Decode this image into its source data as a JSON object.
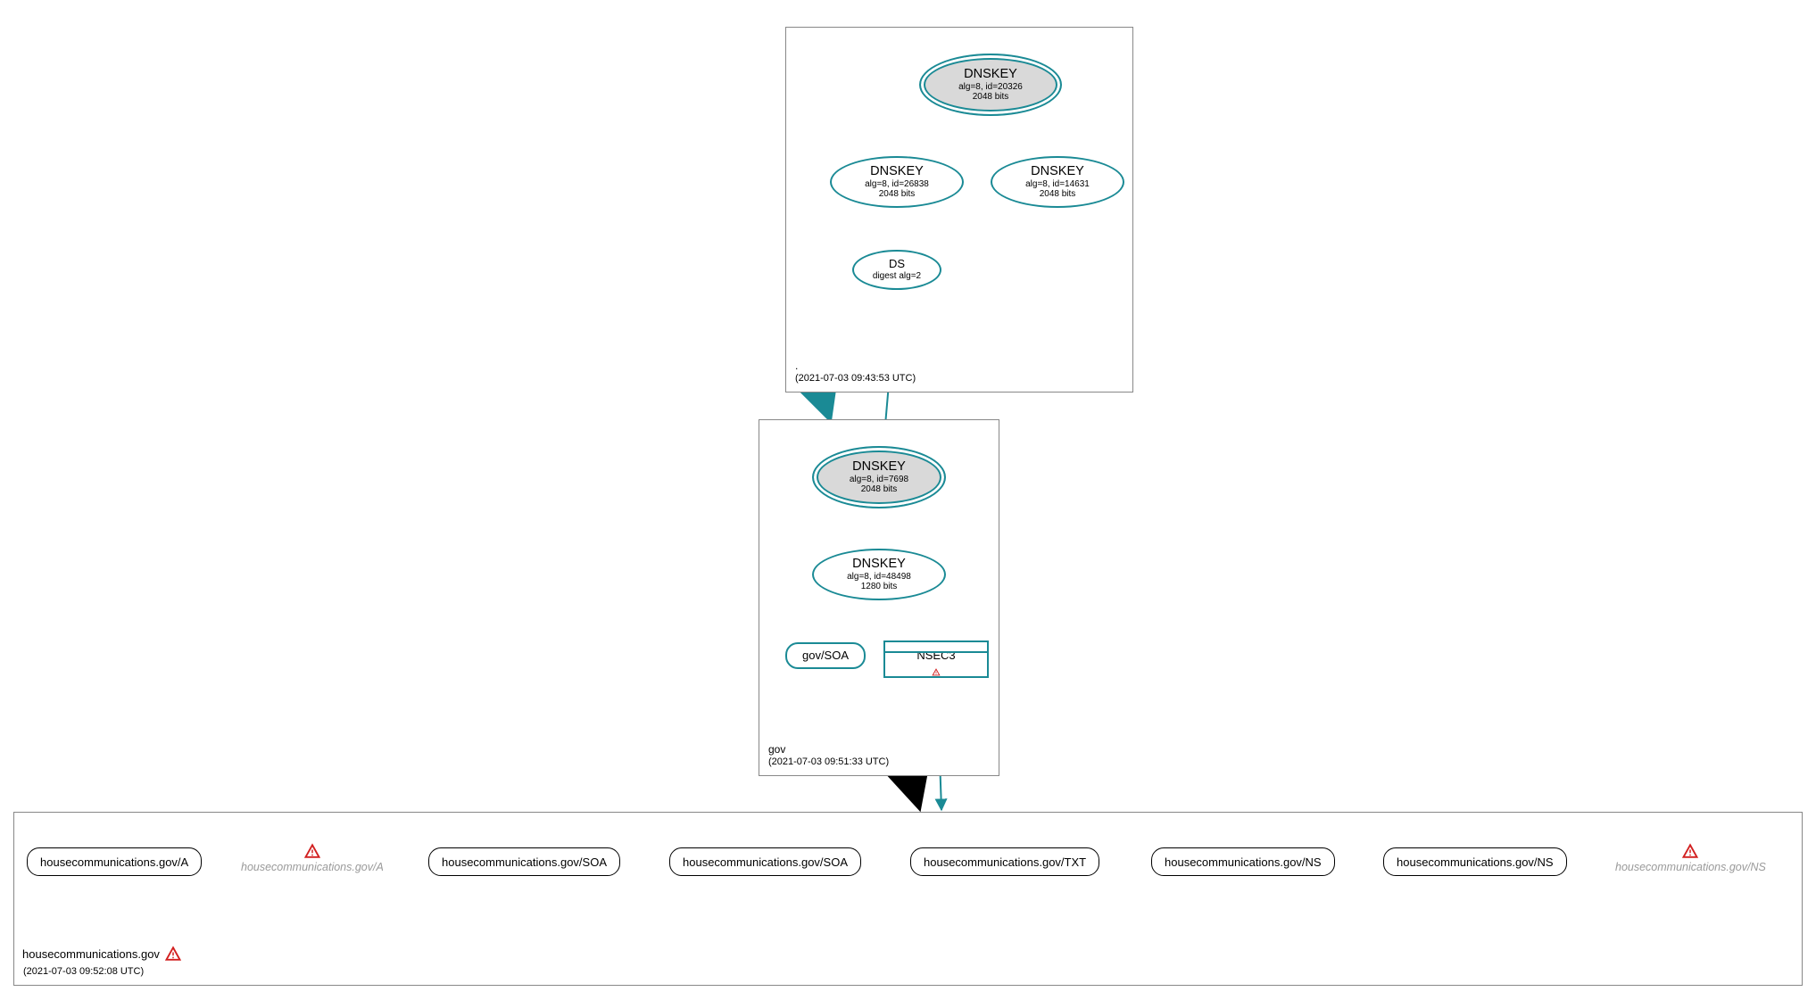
{
  "colors": {
    "teal": "#1a8a95",
    "gray_fill": "#d9d9d9",
    "warn_red": "#d22020"
  },
  "zones": {
    "root": {
      "name": ".",
      "timestamp": "(2021-07-03 09:43:53 UTC)"
    },
    "gov": {
      "name": "gov",
      "timestamp": "(2021-07-03 09:51:33 UTC)"
    },
    "domain": {
      "name": "housecommunications.gov",
      "timestamp": "(2021-07-03 09:52:08 UTC)"
    }
  },
  "nodes": {
    "root_ksk": {
      "title": "DNSKEY",
      "line2": "alg=8, id=20326",
      "line3": "2048 bits"
    },
    "root_zsk1": {
      "title": "DNSKEY",
      "line2": "alg=8, id=26838",
      "line3": "2048 bits"
    },
    "root_zsk2": {
      "title": "DNSKEY",
      "line2": "alg=8, id=14631",
      "line3": "2048 bits"
    },
    "root_ds": {
      "title": "DS",
      "line2": "digest alg=2"
    },
    "gov_ksk": {
      "title": "DNSKEY",
      "line2": "alg=8, id=7698",
      "line3": "2048 bits"
    },
    "gov_zsk": {
      "title": "DNSKEY",
      "line2": "alg=8, id=48498",
      "line3": "1280 bits"
    },
    "gov_soa": {
      "label": "gov/SOA"
    },
    "nsec3": {
      "label": "NSEC3"
    }
  },
  "rr": {
    "a": "housecommunications.gov/A",
    "a_gray": "housecommunications.gov/A",
    "soa1": "housecommunications.gov/SOA",
    "soa2": "housecommunications.gov/SOA",
    "txt": "housecommunications.gov/TXT",
    "ns1": "housecommunications.gov/NS",
    "ns2": "housecommunications.gov/NS",
    "ns_gray": "housecommunications.gov/NS"
  }
}
